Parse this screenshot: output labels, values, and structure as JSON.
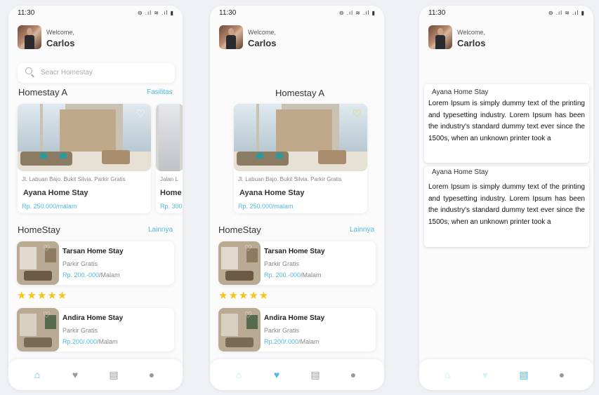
{
  "colors": {
    "accent": "#4fb8df",
    "star": "#f5c518",
    "background": "#fbfbfc"
  },
  "status": {
    "time": "11:30",
    "icons": "⊖ .ıl ≋ .ıl ▮"
  },
  "user": {
    "welcome": "Welcome,",
    "name": "Carlos"
  },
  "search": {
    "placeholder": "Seacr Homestay"
  },
  "featured": {
    "title": "Homestay A",
    "link": "Fasilitas",
    "card": {
      "address": "Jl. Labuan Bajo. Bukit Silvia. Parkir Gratis",
      "name": "Ayana Home Stay",
      "price": "Rp. 250.000/malam"
    },
    "peek_card": {
      "address": "Jalan L",
      "name": "Home",
      "price": "Rp. 300"
    }
  },
  "homestay": {
    "title": "HomeStay",
    "link": "Lainnya",
    "items": [
      {
        "name": "Tarsan Home Stay",
        "sub": "Parkir Gratis",
        "price": "Rp. 200.-000",
        "unit": "/Malam"
      },
      {
        "name": "Andira Home Stay",
        "sub": "Parkir Gratis",
        "price": "Rp.200/.000",
        "unit": "/Malam"
      }
    ],
    "rating": 5,
    "stars": "★★★★★"
  },
  "details": [
    {
      "title": "Ayana Home Stay",
      "text": "Lorem Ipsum is simply dummy text of the printing and typesetting industry. Lorem Ipsum has been the industry's standard dummy text ever since the 1500s, when an unknown printer took a"
    },
    {
      "title": "Ayana Home Stay",
      "text": "Lorem Ipsum is simply dummy text of the printing and typesetting industry. Lorem Ipsum has been the industry's standard dummy text ever since the 1500s, when an unknown printer took a"
    }
  ],
  "nav": {
    "icons": [
      "home-icon",
      "heart-icon",
      "news-icon",
      "profile-icon"
    ],
    "glyphs": [
      "⌂",
      "♥",
      "▤",
      "●"
    ],
    "active_by_screen": [
      "home-icon",
      "heart-icon",
      "news-icon"
    ]
  }
}
